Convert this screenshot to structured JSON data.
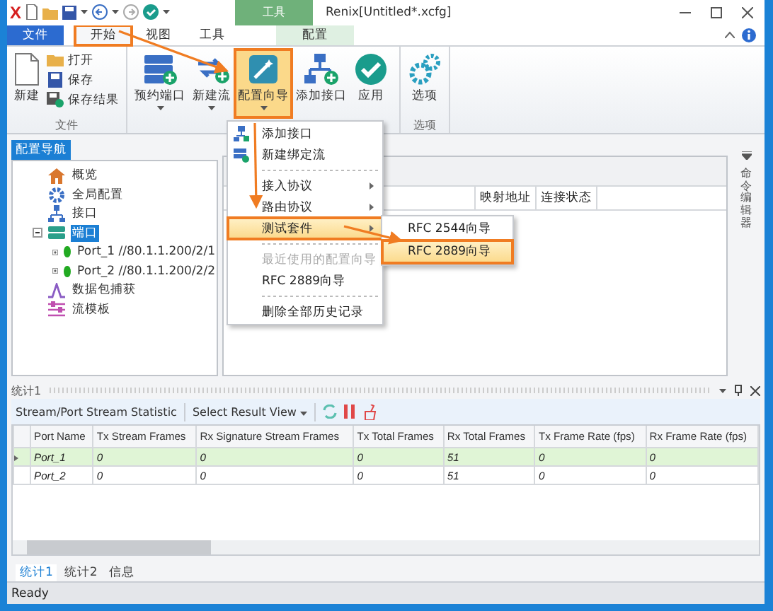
{
  "window": {
    "logo": "X",
    "title": "Renix[Untitled*.xcfg]"
  },
  "ribbon": {
    "file_tab": "文件",
    "tabs": [
      {
        "label": "开始",
        "selected": true,
        "highlighted": true
      },
      {
        "label": "视图",
        "selected": false,
        "highlighted": false
      },
      {
        "label": "工具",
        "selected": false,
        "highlighted": false
      }
    ],
    "contextual": {
      "group": "工具",
      "tab": "配置",
      "selected": false
    },
    "groups": [
      {
        "label": "文件",
        "items": [
          {
            "kind": "large",
            "label": "新建",
            "dropdown": false,
            "highlighted": false
          },
          {
            "kind": "small",
            "label": "打开"
          },
          {
            "kind": "small",
            "label": "保存"
          },
          {
            "kind": "small",
            "label": "保存结果"
          }
        ]
      },
      {
        "items": [
          {
            "kind": "large",
            "label": "预约端口",
            "dropdown": true,
            "highlighted": false
          },
          {
            "kind": "large",
            "label": "新建流",
            "dropdown": true,
            "highlighted": false
          },
          {
            "kind": "large",
            "label": "配置向导",
            "dropdown": true,
            "highlighted": true
          },
          {
            "kind": "large",
            "label": "添加接口",
            "dropdown": false,
            "highlighted": false
          },
          {
            "kind": "large",
            "label": "应用",
            "dropdown": false,
            "highlighted": false
          }
        ]
      },
      {
        "label": "选项",
        "items": [
          {
            "kind": "large",
            "label": "选项",
            "dropdown": false,
            "highlighted": false
          }
        ]
      }
    ]
  },
  "menu": {
    "items": [
      {
        "kind": "command",
        "label": "添加接口",
        "selected": false,
        "highlighted": false
      },
      {
        "kind": "command",
        "label": "新建绑定流",
        "selected": false,
        "highlighted": false
      },
      {
        "kind": "separator"
      },
      {
        "kind": "submenu",
        "label": "接入协议",
        "selected": false,
        "highlighted": false
      },
      {
        "kind": "submenu",
        "label": "路由协议",
        "selected": false,
        "highlighted": false
      },
      {
        "kind": "submenu",
        "label": "测试套件",
        "selected": true,
        "highlighted": true
      },
      {
        "kind": "separator"
      },
      {
        "kind": "command",
        "label": "最近使用的配置向导",
        "disabled": true,
        "selected": false,
        "highlighted": false
      },
      {
        "kind": "command",
        "label": "RFC 2889向导",
        "selected": false,
        "highlighted": false
      },
      {
        "kind": "separator"
      },
      {
        "kind": "command",
        "label": "删除全部历史记录",
        "selected": false,
        "highlighted": false
      }
    ]
  },
  "submenu": {
    "items": [
      {
        "label": "RFC 2544向导",
        "selected": false,
        "highlighted": false
      },
      {
        "label": "RFC 2889向导",
        "selected": true,
        "highlighted": true
      }
    ]
  },
  "navigator": {
    "title": "配置导航",
    "items": [
      {
        "label": "概览",
        "selected": false
      },
      {
        "label": "全局配置",
        "selected": false
      },
      {
        "label": "接口",
        "selected": false
      },
      {
        "label": "端口",
        "selected": true,
        "expanded": true,
        "children": [
          {
            "label": "Port_1 //80.1.1.200/2/1",
            "expanded": false,
            "color": "#22aa22"
          },
          {
            "label": "Port_2 //80.1.1.200/2/2",
            "expanded": false,
            "color": "#22aa22"
          }
        ]
      },
      {
        "label": "数据包捕获",
        "selected": false
      },
      {
        "label": "流模板",
        "selected": false
      }
    ]
  },
  "port_table": {
    "columns": [
      "映射地址",
      "连接状态"
    ]
  },
  "side_panel": {
    "title": "命令编辑器"
  },
  "stats_panel": {
    "title": "统计1",
    "view": "Stream/Port Stream Statistic",
    "select": "Select Result View",
    "columns": [
      "Port Name",
      "Tx Stream Frames",
      "Rx Signature Stream Frames",
      "Tx Total Frames",
      "Rx Total Frames",
      "Tx Frame Rate (fps)",
      "Rx Frame Rate (fps)"
    ],
    "rows": [
      {
        "selected": true,
        "cells": [
          "Port_1",
          "0",
          "0",
          "0",
          "51",
          "0",
          "0"
        ]
      },
      {
        "selected": false,
        "cells": [
          "Port_2",
          "0",
          "0",
          "0",
          "51",
          "0",
          "0"
        ]
      }
    ]
  },
  "bottom_tabs": [
    {
      "label": "统计1",
      "selected": true
    },
    {
      "label": "统计2",
      "selected": false
    },
    {
      "label": "信息",
      "selected": false
    }
  ],
  "status_bar": "Ready"
}
